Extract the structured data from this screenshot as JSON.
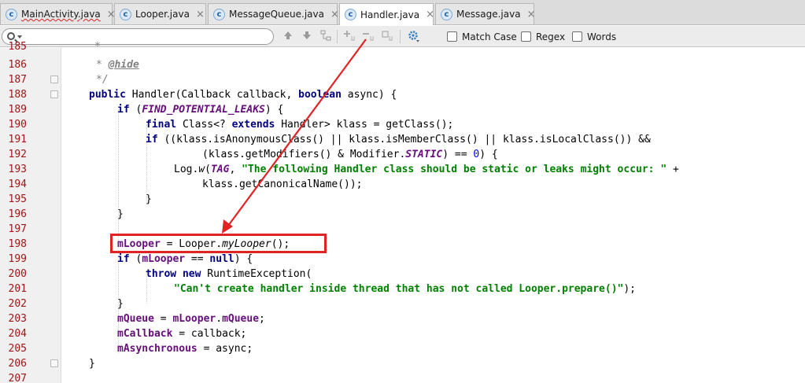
{
  "tabs": [
    {
      "label": "MainActivity.java",
      "icon": "class-icon",
      "active": false,
      "squiggle": true
    },
    {
      "label": "Looper.java",
      "icon": "class-icon",
      "active": false,
      "squiggle": false
    },
    {
      "label": "MessageQueue.java",
      "icon": "class-icon",
      "active": false,
      "squiggle": false
    },
    {
      "label": "Handler.java",
      "icon": "class-icon",
      "active": true,
      "squiggle": false
    },
    {
      "label": "Message.java",
      "icon": "class-icon",
      "active": false,
      "squiggle": false
    }
  ],
  "tab_icon_letter": "c",
  "tab_close_glyph": "×",
  "find": {
    "query": "",
    "options": [
      {
        "label": "Match Case",
        "checked": false
      },
      {
        "label": "Regex",
        "checked": false
      },
      {
        "label": "Words",
        "checked": false
      }
    ]
  },
  "line_numbers": [
    "185",
    "186",
    "187",
    "188",
    "189",
    "190",
    "191",
    "192",
    "193",
    "194",
    "195",
    "196",
    "197",
    "198",
    "199",
    "200",
    "201",
    "202",
    "203",
    "204",
    "205",
    "206",
    "207"
  ],
  "code": {
    "l186_star": "*",
    "l186_tag": "@hide",
    "l187": "*/",
    "l188_public": "public",
    "l188_sig": "Handler(Callback callback, ",
    "l188_boolean": "boolean",
    "l188_rest": " async) {",
    "l189_if": "if",
    "l189_open": " (",
    "l189_flag": "FIND_POTENTIAL_LEAKS",
    "l189_close": ") {",
    "l190_final": "final",
    "l190_a": " Class<? ",
    "l190_extends": "extends",
    "l190_b": " Handler> klass = getClass();",
    "l191_if": "if",
    "l191_rest": " ((klass.isAnonymousClass() || klass.isMemberClass() || klass.isLocalClass()) &&",
    "l192_a": "(klass.getModifiers() & Modifier.",
    "l192_static": "STATIC",
    "l192_b": ") == ",
    "l192_zero": "0",
    "l192_c": ") {",
    "l193_a": "Log.",
    "l193_w": "w",
    "l193_b": "(",
    "l193_tag": "TAG",
    "l193_c": ", ",
    "l193_str": "\"The following Handler class should be static or leaks might occur: \"",
    "l193_d": " +",
    "l194": "klass.getCanonicalName());",
    "l195": "}",
    "l196": "}",
    "l198_field": "mLooper",
    "l198_a": " = Looper.",
    "l198_method": "myLooper",
    "l198_b": "();",
    "l199_if": "if",
    "l199_a": " (",
    "l199_field": "mLooper",
    "l199_b": " == ",
    "l199_null": "null",
    "l199_c": ") {",
    "l200_throw": "throw",
    "l200_new": "new",
    "l200_rest": " RuntimeException(",
    "l201_str": "\"Can't create handler inside thread that has not called Looper.prepare()\"",
    "l201_rest": ");",
    "l202": "}",
    "l203_f1": "mQueue",
    "l203_a": " = ",
    "l203_f2": "mLooper",
    "l203_b": ".",
    "l203_f3": "mQueue",
    "l203_c": ";",
    "l204_f": "mCallback",
    "l204_rest": " = callback;",
    "l205_f": "mAsynchronous",
    "l205_rest": " = async;",
    "l206": "}"
  },
  "annotation": {
    "color": "#e02323"
  }
}
